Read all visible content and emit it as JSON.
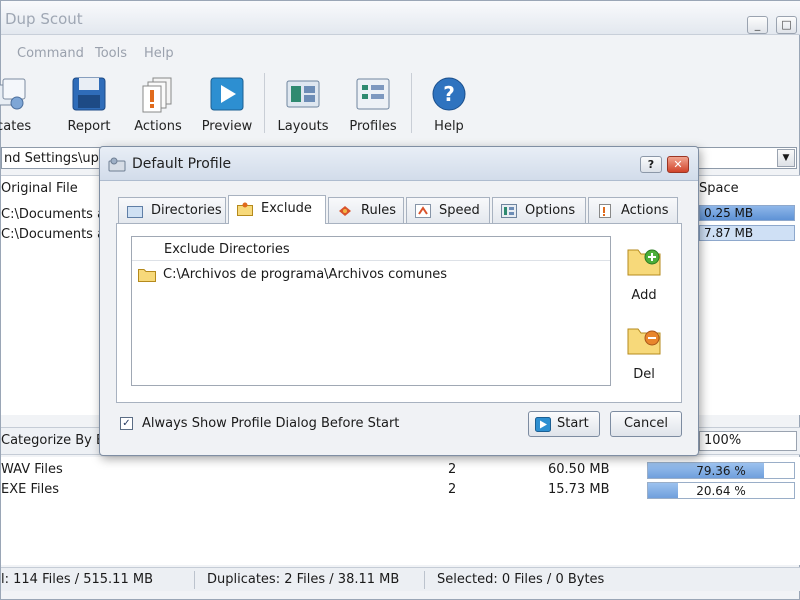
{
  "app": {
    "title": "Dup Scout"
  },
  "window_controls": {
    "minimize": "_",
    "restore": "□",
    "close": "×"
  },
  "menu": [
    "Command",
    "Tools",
    "Help"
  ],
  "toolbar": {
    "items": [
      {
        "label": "licates",
        "icon": "duplicates-icon"
      },
      {
        "label": "Report",
        "icon": "save-disk-icon"
      },
      {
        "label": "Actions",
        "icon": "actions-icon"
      },
      {
        "label": "Preview",
        "icon": "play-icon"
      },
      {
        "label": "Layouts",
        "icon": "layouts-icon"
      },
      {
        "label": "Profiles",
        "icon": "profiles-icon"
      },
      {
        "label": "Help",
        "icon": "help-icon"
      }
    ]
  },
  "path": {
    "value": "nd Settings\\uptod"
  },
  "upper": {
    "col_original": "Original File",
    "col_space": "Space",
    "rows": [
      {
        "file": "C:\\Documents ar",
        "space": "0.25 MB",
        "fraction": 1.0
      },
      {
        "file": "C:\\Documents ar",
        "space": "7.87 MB",
        "fraction": 0.0
      }
    ]
  },
  "category": {
    "label": "Categorize By Ex",
    "percent": "100%"
  },
  "lower": {
    "rows": [
      {
        "type": "WAV Files",
        "count": "2",
        "size": "60.50 MB",
        "percent": "79.36 %",
        "fraction": 0.7936
      },
      {
        "type": "EXE Files",
        "count": "2",
        "size": "15.73 MB",
        "percent": "20.64 %",
        "fraction": 0.2064
      }
    ]
  },
  "status": {
    "total": "l: 114 Files / 515.11 MB",
    "duplicates": "Duplicates: 2 Files / 38.11 MB",
    "selected": "Selected: 0 Files / 0 Bytes"
  },
  "dialog": {
    "title": "Default Profile",
    "help_btn": "?",
    "close_btn": "✕",
    "tabs": [
      {
        "label": "Directories",
        "icon": "folder-icon"
      },
      {
        "label": "Exclude",
        "icon": "exclude-folder-icon"
      },
      {
        "label": "Rules",
        "icon": "rules-icon"
      },
      {
        "label": "Speed",
        "icon": "speed-icon"
      },
      {
        "label": "Options",
        "icon": "options-icon"
      },
      {
        "label": "Actions",
        "icon": "actions-icon"
      }
    ],
    "active_tab": "Exclude",
    "exclude_header": "Exclude Directories",
    "exclude_items": [
      "C:\\Archivos de programa\\Archivos comunes"
    ],
    "add_label": "Add",
    "del_label": "Del",
    "always_show_label": "Always Show Profile Dialog Before Start",
    "always_show_checked": true,
    "start_label": "Start",
    "cancel_label": "Cancel"
  }
}
